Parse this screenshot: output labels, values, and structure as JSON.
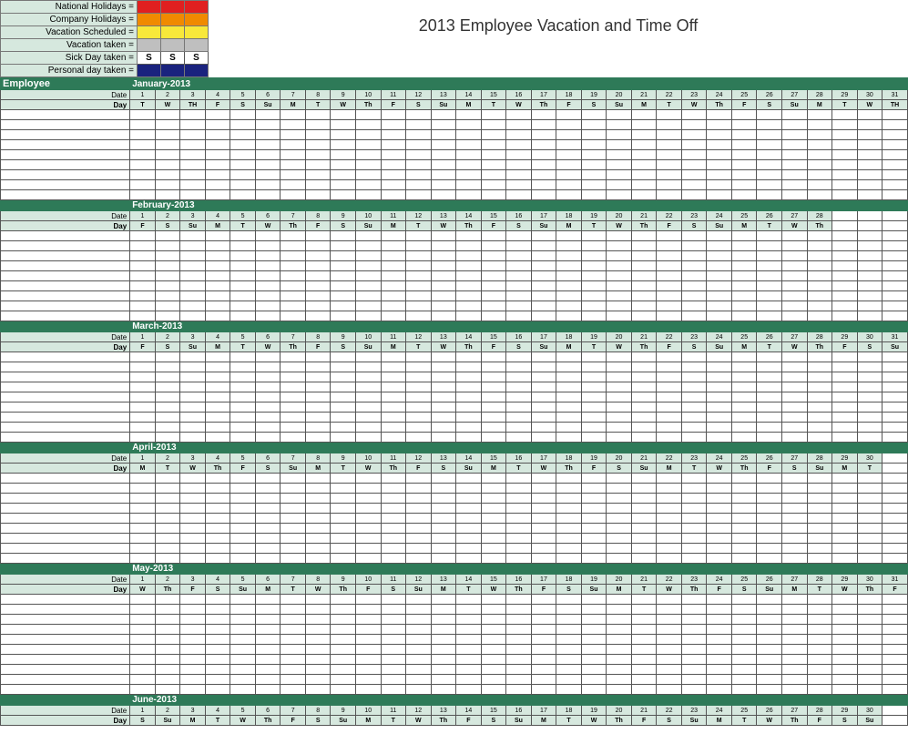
{
  "title": "2013 Employee Vacation and Time Off",
  "employee_header": "Employee",
  "date_label": "Date",
  "day_label": "Day",
  "legend": {
    "items": [
      {
        "label": "National Holidays =",
        "colors": [
          "#e02020",
          "#e02020",
          "#e02020"
        ],
        "text": [
          "",
          "",
          ""
        ]
      },
      {
        "label": "Company Holidays =",
        "colors": [
          "#f08a00",
          "#f08a00",
          "#f08a00"
        ],
        "text": [
          "",
          "",
          ""
        ]
      },
      {
        "label": "Vacation Scheduled =",
        "colors": [
          "#f8e83a",
          "#f8e83a",
          "#f8e83a"
        ],
        "text": [
          "",
          "",
          ""
        ]
      },
      {
        "label": "Vacation taken =",
        "colors": [
          "#bfbfbf",
          "#bfbfbf",
          "#bfbfbf"
        ],
        "text": [
          "",
          "",
          ""
        ]
      },
      {
        "label": "Sick Day taken =",
        "colors": [
          "#ffffff",
          "#ffffff",
          "#ffffff"
        ],
        "text": [
          "S",
          "S",
          "S"
        ]
      },
      {
        "label": "Personal day taken =",
        "colors": [
          "#1a237e",
          "#1a237e",
          "#1a237e"
        ],
        "text": [
          "",
          "",
          ""
        ]
      }
    ]
  },
  "months": [
    {
      "name": "January-2013",
      "dates": [
        "1",
        "2",
        "3",
        "4",
        "5",
        "6",
        "7",
        "8",
        "9",
        "10",
        "11",
        "12",
        "13",
        "14",
        "15",
        "16",
        "17",
        "18",
        "19",
        "20",
        "21",
        "22",
        "23",
        "24",
        "25",
        "26",
        "27",
        "28",
        "29",
        "30",
        "31"
      ],
      "days": [
        "T",
        "W",
        "TH",
        "F",
        "S",
        "Su",
        "M",
        "T",
        "W",
        "Th",
        "F",
        "S",
        "Su",
        "M",
        "T",
        "W",
        "Th",
        "F",
        "S",
        "Su",
        "M",
        "T",
        "W",
        "Th",
        "F",
        "S",
        "Su",
        "M",
        "T",
        "W",
        "TH"
      ],
      "blank_rows": 9
    },
    {
      "name": "February-2013",
      "dates": [
        "1",
        "2",
        "3",
        "4",
        "5",
        "6",
        "7",
        "8",
        "9",
        "10",
        "11",
        "12",
        "13",
        "14",
        "15",
        "16",
        "17",
        "18",
        "19",
        "20",
        "21",
        "22",
        "23",
        "24",
        "25",
        "26",
        "27",
        "28"
      ],
      "days": [
        "F",
        "S",
        "Su",
        "M",
        "T",
        "W",
        "Th",
        "F",
        "S",
        "Su",
        "M",
        "T",
        "W",
        "Th",
        "F",
        "S",
        "Su",
        "M",
        "T",
        "W",
        "Th",
        "F",
        "S",
        "Su",
        "M",
        "T",
        "W",
        "Th"
      ],
      "blank_rows": 9
    },
    {
      "name": "March-2013",
      "dates": [
        "1",
        "2",
        "3",
        "4",
        "5",
        "6",
        "7",
        "8",
        "9",
        "10",
        "11",
        "12",
        "13",
        "14",
        "15",
        "16",
        "17",
        "18",
        "19",
        "20",
        "21",
        "22",
        "23",
        "24",
        "25",
        "26",
        "27",
        "28",
        "29",
        "30",
        "31"
      ],
      "days": [
        "F",
        "S",
        "Su",
        "M",
        "T",
        "W",
        "Th",
        "F",
        "S",
        "Su",
        "M",
        "T",
        "W",
        "Th",
        "F",
        "S",
        "Su",
        "M",
        "T",
        "W",
        "Th",
        "F",
        "S",
        "Su",
        "M",
        "T",
        "W",
        "Th",
        "F",
        "S",
        "Su"
      ],
      "blank_rows": 9
    },
    {
      "name": "April-2013",
      "dates": [
        "1",
        "2",
        "3",
        "4",
        "5",
        "6",
        "7",
        "8",
        "9",
        "10",
        "11",
        "12",
        "13",
        "14",
        "15",
        "16",
        "17",
        "18",
        "19",
        "20",
        "21",
        "22",
        "23",
        "24",
        "25",
        "26",
        "27",
        "28",
        "29",
        "30"
      ],
      "days": [
        "M",
        "T",
        "W",
        "Th",
        "F",
        "S",
        "Su",
        "M",
        "T",
        "W",
        "Th",
        "F",
        "S",
        "Su",
        "M",
        "T",
        "W",
        "Th",
        "F",
        "S",
        "Su",
        "M",
        "T",
        "W",
        "Th",
        "F",
        "S",
        "Su",
        "M",
        "T"
      ],
      "blank_rows": 9
    },
    {
      "name": "May-2013",
      "dates": [
        "1",
        "2",
        "3",
        "4",
        "5",
        "6",
        "7",
        "8",
        "9",
        "10",
        "11",
        "12",
        "13",
        "14",
        "15",
        "16",
        "17",
        "18",
        "19",
        "20",
        "21",
        "22",
        "23",
        "24",
        "25",
        "26",
        "27",
        "28",
        "29",
        "30",
        "31"
      ],
      "days": [
        "W",
        "Th",
        "F",
        "S",
        "Su",
        "M",
        "T",
        "W",
        "Th",
        "F",
        "S",
        "Su",
        "M",
        "T",
        "W",
        "Th",
        "F",
        "S",
        "Su",
        "M",
        "T",
        "W",
        "Th",
        "F",
        "S",
        "Su",
        "M",
        "T",
        "W",
        "Th",
        "F"
      ],
      "blank_rows": 10
    },
    {
      "name": "June-2013",
      "dates": [
        "1",
        "2",
        "3",
        "4",
        "5",
        "6",
        "7",
        "8",
        "9",
        "10",
        "11",
        "12",
        "13",
        "14",
        "15",
        "16",
        "17",
        "18",
        "19",
        "20",
        "21",
        "22",
        "23",
        "24",
        "25",
        "26",
        "27",
        "28",
        "29",
        "30"
      ],
      "days": [
        "S",
        "Su",
        "M",
        "T",
        "W",
        "Th",
        "F",
        "S",
        "Su",
        "M",
        "T",
        "W",
        "Th",
        "F",
        "S",
        "Su",
        "M",
        "T",
        "W",
        "Th",
        "F",
        "S",
        "Su",
        "M",
        "T",
        "W",
        "Th",
        "F",
        "S",
        "Su"
      ],
      "blank_rows": 0
    }
  ],
  "max_days": 31
}
